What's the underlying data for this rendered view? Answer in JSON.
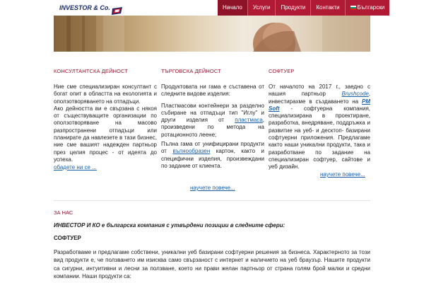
{
  "header": {
    "logo_text": "INVESTOR & Co.",
    "nav": [
      {
        "label": "Начало",
        "active": true
      },
      {
        "label": "Услуги",
        "active": false
      },
      {
        "label": "Продукти",
        "active": false
      },
      {
        "label": "Контакти",
        "active": false
      },
      {
        "label": "Български",
        "active": false,
        "flag": "flag-bg-icon"
      }
    ],
    "accent_color": "#b11a35"
  },
  "columns": {
    "consulting": {
      "title": "КОНСУЛТАНТСКА ДЕЙНОСТ",
      "p1": "Ние сме специализиран консултант с богат опит в областта на екологията и оползотворяването на отпадъци.",
      "p2": "Ако дейността ви е свързана с някоя от съществуващите организации по оползотворяване на масово разпространени отпадъци или планирате да навлезете в тази бизнес, ние сме вашият надежден партньор през целия процес - от идеята до успеха.",
      "more": "обадете ни се ..."
    },
    "trade": {
      "title": "ТЪРГОВСКА ДЕЙНОСТ",
      "p1": "Продуктовата ни гама е съставена от следните видове изделия:",
      "p2_a": "Пластмасови контейнери за разделно събиране на отпадъци тип \"Иглу\" и други изделия от ",
      "p2_link": "пластмаса",
      "p2_b": ", произведени по метода на ротационното леене;",
      "p3_a": "Пълна гама от унифицирани продукти от ",
      "p3_link": "вълнообразен",
      "p3_b": " картон, както и специфични изделия, произвеждани по задание от клиента.",
      "more": "научете повече..."
    },
    "software": {
      "title": "СОФТУЕР",
      "p1_a": "От началото на 2017 г., заедно с нашия партньор ",
      "p1_link1": "Brushcode",
      "p1_b": ", инвестирахме в създаването на ",
      "p1_link2": "PM Soft",
      "p1_c": " - софтуерна компания, специализирана в проектиране, разработка, внедряване, поддръжка и развитие на уеб- и десктоп- базирани софтуерни приложения. Предлагаме както наши уникални продукти, така и разработване по задание на специализиран софтуер, сайтове и уеб дизайн.",
      "more": "научете повече..."
    }
  },
  "about": {
    "title": "ЗА НАС",
    "intro": "ИНВЕСТОР И КО е българска компания с утвърдени позиции в следните сфери:",
    "sub_title": "СОФТУЕР",
    "body": "Разработваме и предлагаме собствени, уникални уеб базирани софтуерни решения за бизнеса. Характерното за този вид продукти е, че ползването им изисква само свързаност с интернет и наличието на уеб браузър. Нашите продукти са сигурни, интуитивни и лесни за ползване, което ни прави желан партньор от страна голям брой малки и средни компании. Наши продукти са:"
  }
}
